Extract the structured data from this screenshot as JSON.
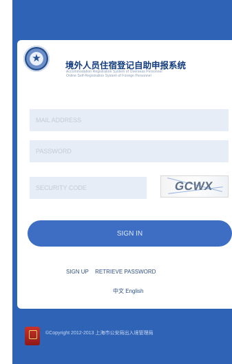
{
  "app": {
    "title": "境外人员住宿登记自助申报系统",
    "subtitle_lines": [
      "Accommodation Registration System of Overseas Personnel",
      "Online Self-Registration System of Foreign Personnel"
    ]
  },
  "form": {
    "email_placeholder": "MAIL ADDRESS",
    "password_placeholder": "PASSWORD",
    "security_placeholder": "SECURITY CODE",
    "captcha_code": "GCWX",
    "signin_label": "SIGN IN"
  },
  "links": {
    "signup": "SIGN UP",
    "retrieve_password": "RETRIEVE PASSWORD",
    "chinese": "中文",
    "english": "English"
  },
  "footer": {
    "copyright": "©Copyright 2012-2013 上海市公安局出入境管理局"
  },
  "colors": {
    "background": "#2f63b6",
    "button": "#3d6ec4",
    "field": "#e7edf7",
    "title": "#123c7f"
  },
  "icons": {
    "logo": "police-emblem-icon",
    "footer": "shield-icon"
  }
}
